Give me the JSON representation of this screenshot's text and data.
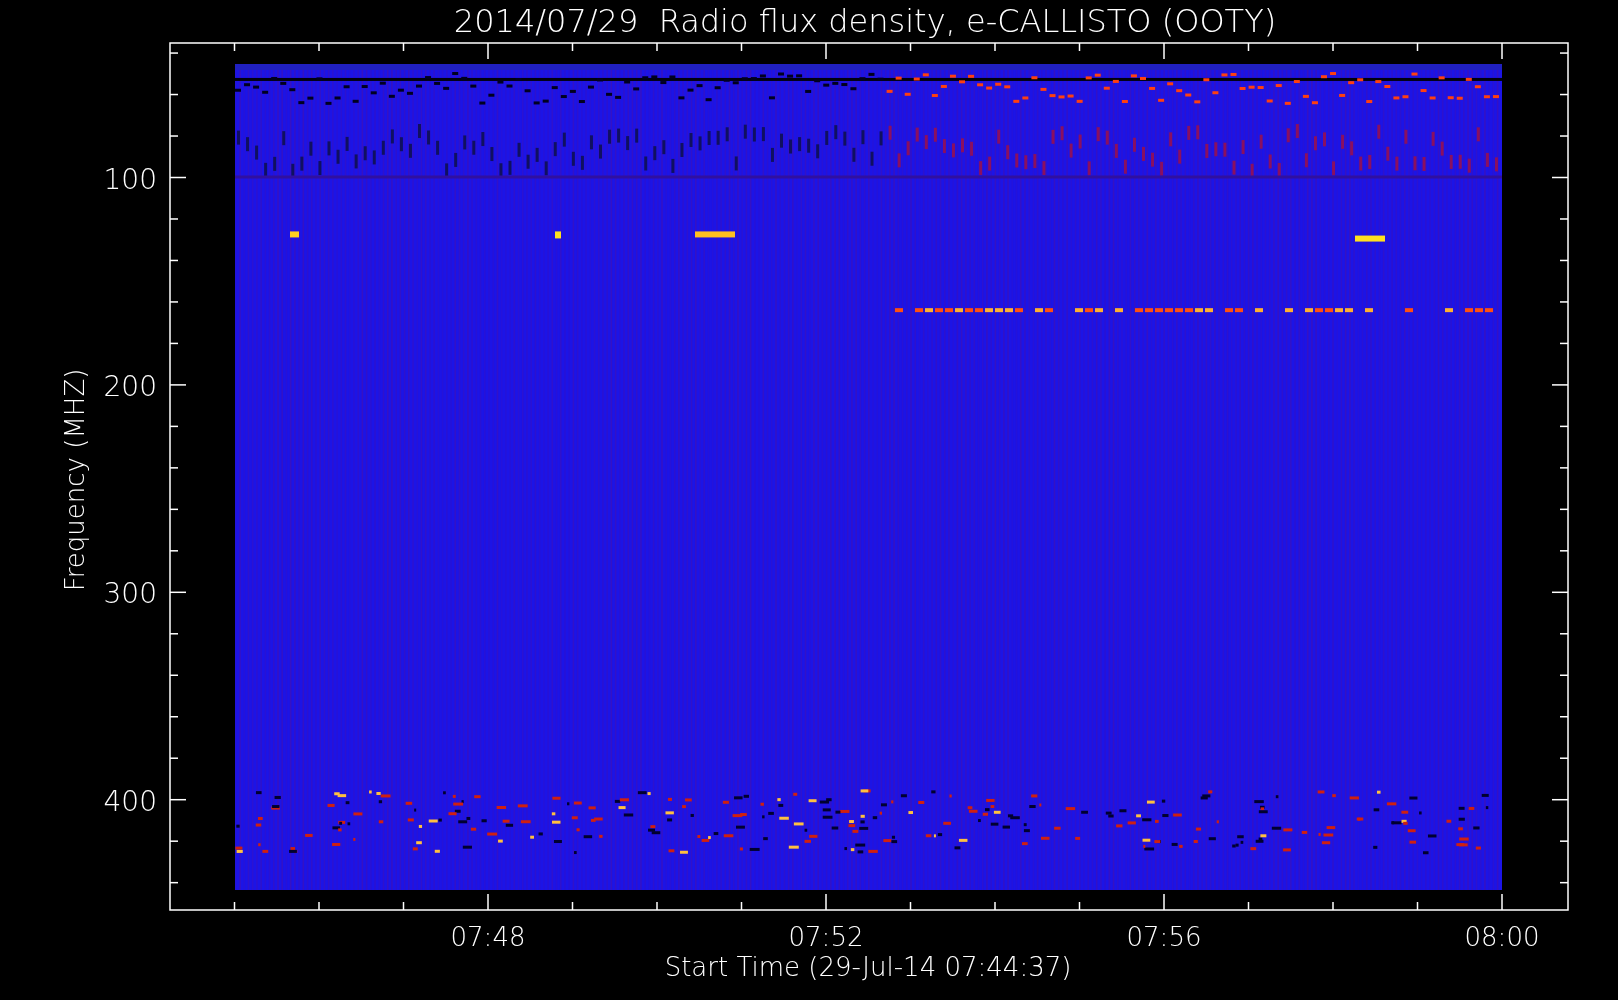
{
  "title": "2014/07/29  Radio flux density, e-CALLISTO (OOTY)",
  "y_axis": {
    "label": "Frequency (MHZ)",
    "ticks": [
      "100",
      "200",
      "300",
      "400"
    ]
  },
  "x_axis": {
    "label": "Start Time (29-Jul-14 07:44:37)",
    "ticks": [
      "07:48",
      "07:52",
      "07:56",
      "08:00"
    ]
  }
}
